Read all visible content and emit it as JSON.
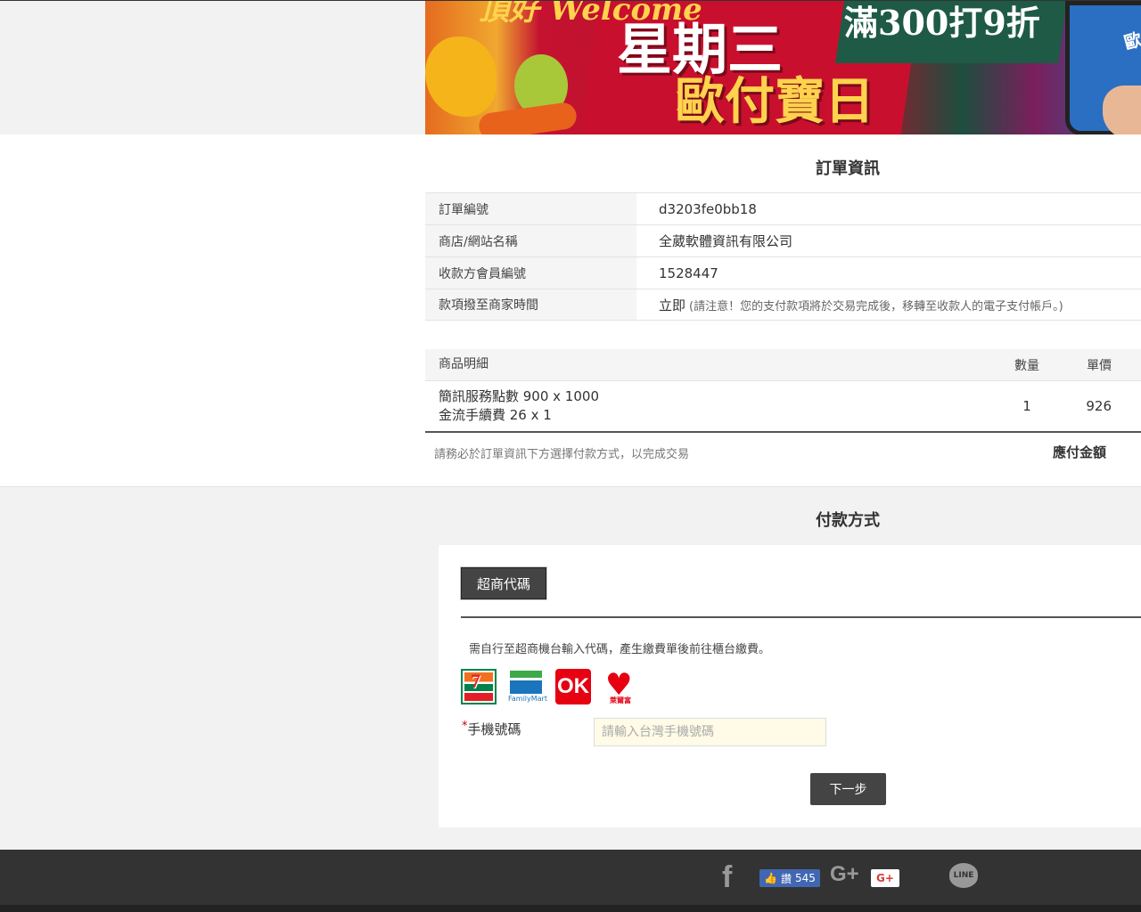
{
  "banner": {
    "top_text": "頂好 Welcome",
    "day_text": "星期三",
    "sub_text": "歐付寶日",
    "deal_text": "滿300打9折",
    "app_text": "歐付寶",
    "arrow": "➤"
  },
  "order": {
    "title": "訂單資訊",
    "rows": [
      {
        "key": "訂單編號",
        "value": "d3203fe0bb18",
        "note": ""
      },
      {
        "key": "商店/網站名稱",
        "value": "全葳軟體資訊有限公司",
        "note": ""
      },
      {
        "key": "收款方會員編號",
        "value": "1528447",
        "note": ""
      },
      {
        "key": "款項撥至商家時間",
        "value": "立即",
        "note": "(請注意！您的支付款項將於交易完成後，移轉至收款人的電子支付帳戶。)"
      }
    ]
  },
  "items": {
    "headers": {
      "name": "商品明細",
      "qty": "數量",
      "price": "單價"
    },
    "rows": [
      {
        "line1": "簡訊服務點數 900 x 1000",
        "line2": "金流手續費 26 x 1",
        "qty": "1",
        "price": "926"
      }
    ],
    "hint": "請務必於訂單資訊下方選擇付款方式，以完成交易",
    "due_label": "應付金額"
  },
  "payment": {
    "title": "付款方式",
    "tab_label": "超商代碼",
    "description": "需自行至超商機台輸入代碼，產生繳費單後前往櫃台繳費。",
    "logos": {
      "seven": "7",
      "familymart": "FamilyMart",
      "ok": "OK",
      "hilife_heart": "♥",
      "hilife": "萊爾富"
    },
    "phone_required_mark": "*",
    "phone_label": "手機號碼",
    "phone_placeholder": "請輸入台灣手機號碼",
    "phone_value": "",
    "next_label": "下一步"
  },
  "footer": {
    "facebook_glyph": "f",
    "like_thumb": "👍",
    "like_label": "讚",
    "like_count": "545",
    "gplus_glyph": "G+",
    "gplus_button": "G+",
    "line_label": "LINE"
  },
  "colors": {
    "background": "#f2f2f2",
    "dark_button": "#444444",
    "footer": "#333333",
    "input_bg": "#fffbe6",
    "required": "#cc0000",
    "facebook": "#4267b2"
  }
}
